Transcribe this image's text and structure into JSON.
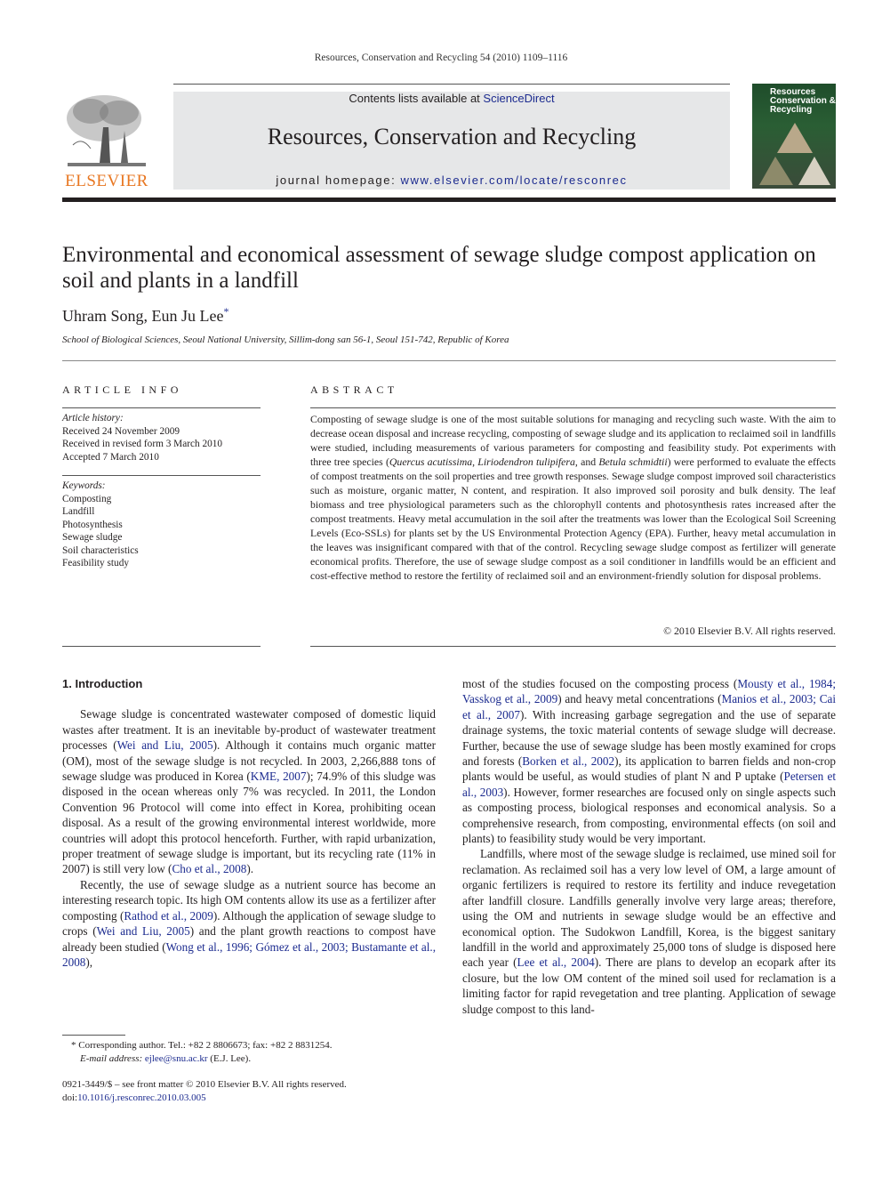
{
  "journal": {
    "running_head": "Resources, Conservation and Recycling 54 (2010) 1109–1116",
    "contents_prefix": "Contents lists available at ",
    "contents_link": "ScienceDirect",
    "title": "Resources, Conservation and Recycling",
    "homepage_prefix": "journal homepage: ",
    "homepage_link": "www.elsevier.com/locate/resconrec",
    "publisher_logo": "ELSEVIER",
    "cover_title_lines": [
      "Resources",
      "Conservation &",
      "Recycling"
    ],
    "accent_color": "#e87722",
    "link_color": "#1c2b8f"
  },
  "article": {
    "title": "Environmental and economical assessment of sewage sludge compost application on soil and plants in a landfill",
    "authors": "Uhram Song, Eun Ju Lee",
    "corresponding_mark": "*",
    "affiliation": "School of Biological Sciences, Seoul National University, Sillim-dong san 56-1, Seoul 151-742, Republic of Korea"
  },
  "article_info": {
    "heading": "ARTICLE INFO",
    "history_label": "Article history:",
    "history": [
      "Received 24 November 2009",
      "Received in revised form 3 March 2010",
      "Accepted 7 March 2010"
    ],
    "keywords_label": "Keywords:",
    "keywords": [
      "Composting",
      "Landfill",
      "Photosynthesis",
      "Sewage sludge",
      "Soil characteristics",
      "Feasibility study"
    ]
  },
  "abstract": {
    "heading": "ABSTRACT",
    "part1": "Composting of sewage sludge is one of the most suitable solutions for managing and recycling such waste. With the aim to decrease ocean disposal and increase recycling, composting of sewage sludge and its application to reclaimed soil in landfills were studied, including measurements of various parameters for composting and feasibility study. Pot experiments with three tree species (",
    "species1": "Quercus acutissima",
    "sep1": ", ",
    "species2": "Liriodendron tulipifera",
    "sep2": ", and ",
    "species3": "Betula schmidtii",
    "part2": ") were performed to evaluate the effects of compost treatments on the soil properties and tree growth responses. Sewage sludge compost improved soil characteristics such as moisture, organic matter, N content, and respiration. It also improved soil porosity and bulk density. The leaf biomass and tree physiological parameters such as the chlorophyll contents and photosynthesis rates increased after the compost treatments. Heavy metal accumulation in the soil after the treatments was lower than the Ecological Soil Screening Levels (Eco-SSLs) for plants set by the US Environmental Protection Agency (EPA). Further, heavy metal accumulation in the leaves was insignificant compared with that of the control. Recycling sewage sludge compost as fertilizer will generate economical profits. Therefore, the use of sewage sludge compost as a soil conditioner in landfills would be an efficient and cost-effective method to restore the fertility of reclaimed soil and an environment-friendly solution for disposal problems.",
    "copyright": "© 2010 Elsevier B.V. All rights reserved."
  },
  "introduction": {
    "heading": "1.  Introduction",
    "p1": [
      {
        "t": "Sewage sludge is concentrated wastewater composed of domestic liquid wastes after treatment. It is an inevitable by-product of wastewater treatment processes ("
      },
      {
        "l": "Wei and Liu, 2005"
      },
      {
        "t": "). Although it contains much organic matter (OM), most of the sewage sludge is not recycled. In 2003, 2,266,888 tons of sewage sludge was produced in Korea ("
      },
      {
        "l": "KME, 2007"
      },
      {
        "t": "); 74.9% of this sludge was disposed in the ocean whereas only 7% was recycled. In 2011, the London Convention 96 Protocol will come into effect in Korea, prohibiting ocean disposal. As a result of the growing environmental interest worldwide, more countries will adopt this protocol henceforth. Further, with rapid urbanization, proper treatment of sewage sludge is important, but its recycling rate (11% in 2007) is still very low ("
      },
      {
        "l": "Cho et al., 2008"
      },
      {
        "t": ")."
      }
    ],
    "p2": [
      {
        "t": "Recently, the use of sewage sludge as a nutrient source has become an interesting research topic. Its high OM contents allow its use as a fertilizer after composting ("
      },
      {
        "l": "Rathod et al., 2009"
      },
      {
        "t": "). Although the application of sewage sludge to crops ("
      },
      {
        "l": "Wei and Liu, 2005"
      },
      {
        "t": ") and the plant growth reactions to compost have already been studied ("
      },
      {
        "l": "Wong et al., 1996; Gómez et al., 2003; Bustamante et al., 2008"
      },
      {
        "t": "),"
      }
    ],
    "p3": [
      {
        "t": "most of the studies focused on the composting process ("
      },
      {
        "l": "Mousty et al., 1984; Vasskog et al., 2009"
      },
      {
        "t": ") and heavy metal concentrations ("
      },
      {
        "l": "Manios et al., 2003; Cai et al., 2007"
      },
      {
        "t": "). With increasing garbage segregation and the use of separate drainage systems, the toxic material contents of sewage sludge will decrease. Further, because the use of sewage sludge has been mostly examined for crops and forests ("
      },
      {
        "l": "Borken et al., 2002"
      },
      {
        "t": "), its application to barren fields and non-crop plants would be useful, as would studies of plant N and P uptake ("
      },
      {
        "l": "Petersen et al., 2003"
      },
      {
        "t": "). However, former researches are focused only on single aspects such as composting process, biological responses and economical analysis. So a comprehensive research, from composting, environmental effects (on soil and plants) to feasibility study would be very important."
      }
    ],
    "p4": [
      {
        "t": "Landfills, where most of the sewage sludge is reclaimed, use mined soil for reclamation. As reclaimed soil has a very low level of OM, a large amount of organic fertilizers is required to restore its fertility and induce revegetation after landfill closure. Landfills generally involve very large areas; therefore, using the OM and nutrients in sewage sludge would be an effective and economical option. The Sudokwon Landfill, Korea, is the biggest sanitary landfill in the world and approximately 25,000 tons of sludge is disposed here each year ("
      },
      {
        "l": "Lee et al., 2004"
      },
      {
        "t": "). There are plans to develop an ecopark after its closure, but the low OM content of the mined soil used for reclamation is a limiting factor for rapid revegetation and tree planting. Application of sewage sludge compost to this land-"
      }
    ]
  },
  "footnote": {
    "mark": "*",
    "corresponding": " Corresponding author. Tel.: +82 2 8806673; fax: +82 2 8831254.",
    "email_label": "E-mail address:",
    "email": "ejlee@snu.ac.kr",
    "email_suffix": " (E.J. Lee)."
  },
  "front_matter": {
    "issn_line": "0921-3449/$ – see front matter © 2010 Elsevier B.V. All rights reserved.",
    "doi_prefix": "doi:",
    "doi": "10.1016/j.resconrec.2010.03.005"
  }
}
